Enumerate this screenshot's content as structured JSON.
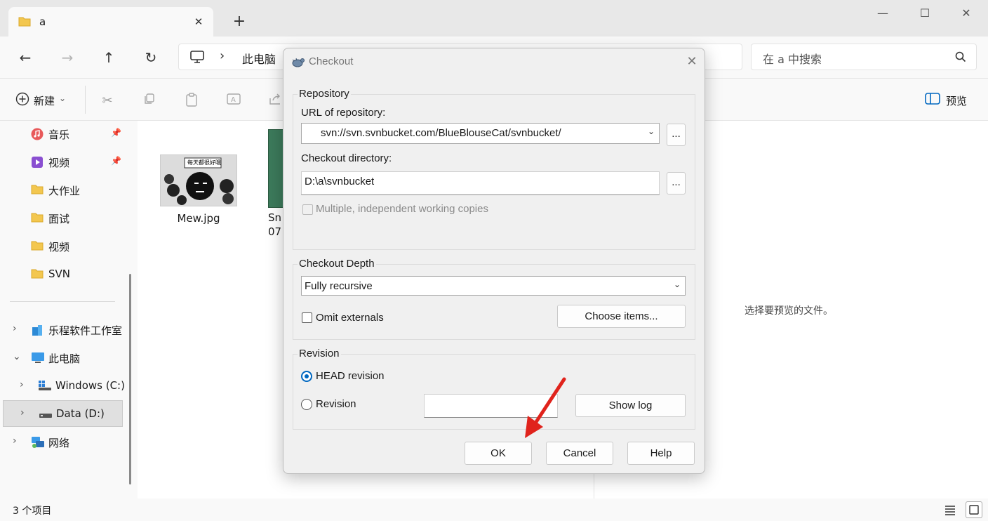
{
  "explorer": {
    "tab_title": "a",
    "tab_close": "✕",
    "new_tab": "+",
    "win_min": "—",
    "win_max": "☐",
    "win_close": "✕",
    "nav": {
      "back": "←",
      "forward": "→",
      "up": "↑",
      "refresh": "↻"
    },
    "address": {
      "chevron": "›",
      "crumb": "此电脑"
    },
    "search_placeholder": "在 a 中搜索",
    "toolbar": {
      "new_label": "新建",
      "new_caret": "⌄",
      "preview_label": "预览"
    },
    "sidebar": {
      "items": [
        {
          "label": "音乐"
        },
        {
          "label": "视频"
        },
        {
          "label": "大作业"
        },
        {
          "label": "面试"
        },
        {
          "label": "视频"
        },
        {
          "label": "SVN"
        },
        {
          "label": "乐程软件工作室"
        },
        {
          "label": "此电脑"
        },
        {
          "label": "Windows (C:)"
        },
        {
          "label": "Data (D:)"
        },
        {
          "label": "网络"
        }
      ]
    },
    "files": [
      {
        "name": "Mew.jpg",
        "thumb_text": "每天都很好哦"
      },
      {
        "name": "Sn\n07"
      }
    ],
    "preview_message": "选择要预览的文件。",
    "status_count": "3 个项目"
  },
  "dialog": {
    "title": "Checkout",
    "close": "✕",
    "repository": {
      "group_label": "Repository",
      "url_label": "URL of repository:",
      "url_value": "svn://svn.svnbucket.com/BlueBlouseCat/svnbucket/",
      "url_browse": "...",
      "dir_label": "Checkout directory:",
      "dir_value": "D:\\a\\svnbucket",
      "dir_browse": "...",
      "multiple_label": "Multiple, independent working copies"
    },
    "depth": {
      "group_label": "Checkout Depth",
      "value": "Fully recursive",
      "omit_label": "Omit externals",
      "choose_items": "Choose items..."
    },
    "revision": {
      "group_label": "Revision",
      "head_label": "HEAD revision",
      "revision_label": "Revision",
      "revision_value": "",
      "show_log": "Show log"
    },
    "buttons": {
      "ok": "OK",
      "cancel": "Cancel",
      "help": "Help"
    }
  },
  "colors": {
    "accent": "#0067c0",
    "arrow": "#e0231c",
    "folder": "#f3c74f"
  }
}
